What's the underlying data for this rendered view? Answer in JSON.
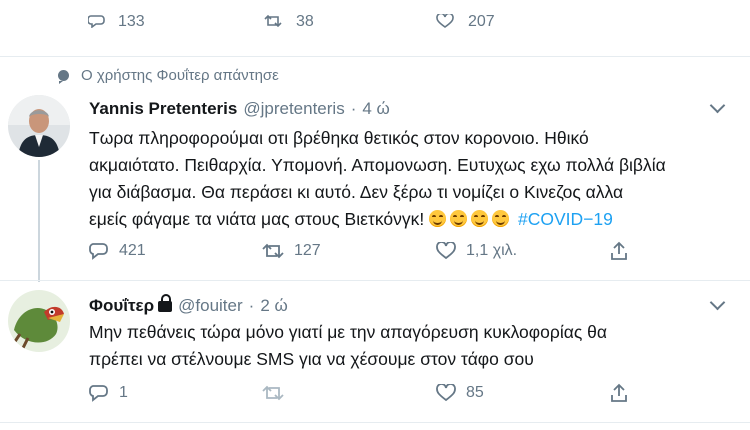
{
  "top_row": {
    "reply_count": "133",
    "retweet_count": "38",
    "like_count": "207"
  },
  "reply_context": "Ο χρήστης Φουΐτερ απάντησε",
  "tweet1": {
    "name": "Yannis Pretenteris",
    "handle": "@jpretenteris",
    "separator": "·",
    "time": "4 ώ",
    "lines": [
      "Τωρα πληροφορούμαι οτι βρέθηκα θετικός στον κορονοιο. Ηθικό",
      "ακμαιότατο. Πειθαρχία. Υπομονή. Απομονωση. Ευτυχως εχω πολλά βιβλία",
      "για διάβασμα. Θα περάσει κι αυτό. Δεν ξέρω τι νομίζει ο Κινεζος αλλα",
      "εμείς φάγαμε τα νιάτα μας στους Βιετκόνγκ!"
    ],
    "hashtag": "#COVID−19",
    "replies": "421",
    "retweets": "127",
    "likes": "1,1 χιλ."
  },
  "tweet2": {
    "name": "Φουΐτερ",
    "handle": "@fouiter",
    "separator": "·",
    "time": "2 ώ",
    "lines": [
      "Μην πεθάνεις τώρα μόνο γιατί με την απαγόρευση κυκλοφορίας θα",
      "πρέπει να στέλνουμε SMS για να χέσουμε στον τάφο σου"
    ],
    "replies": "1",
    "retweets": "",
    "likes": "85"
  },
  "icons": [
    "reply-icon",
    "retweet-icon",
    "like-icon",
    "share-icon",
    "chevron-down-icon",
    "lock-icon",
    "speech-bubble-icon"
  ],
  "colors": {
    "accent": "#1da1f2",
    "muted": "#657786",
    "divider": "#e6ecf0"
  }
}
